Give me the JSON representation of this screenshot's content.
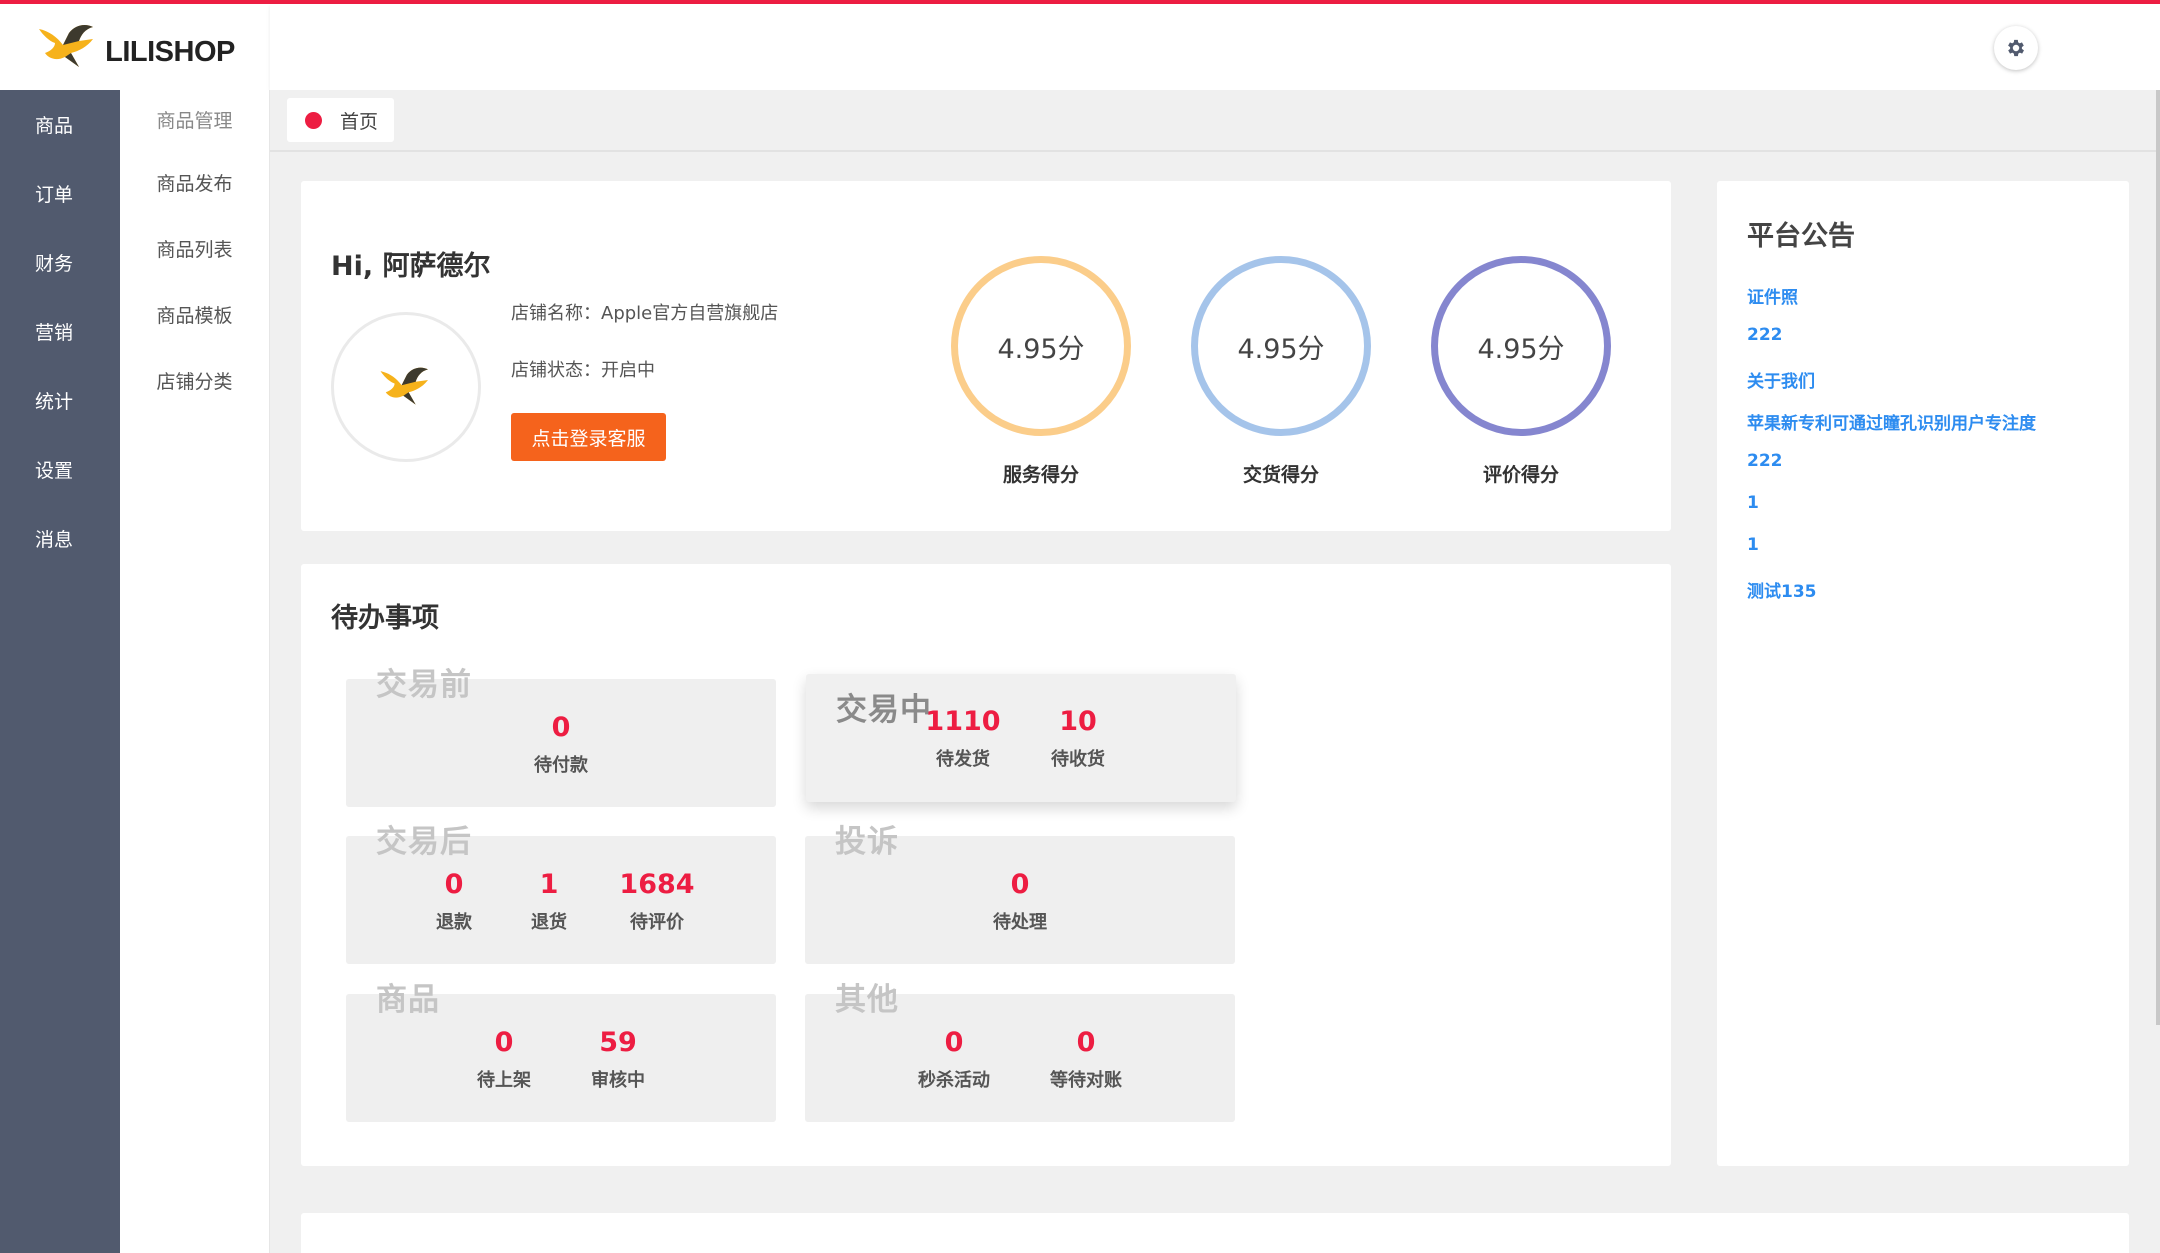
{
  "brand": {
    "name": "LILISHOP"
  },
  "sidebar": {
    "items": [
      "商品",
      "订单",
      "财务",
      "营销",
      "统计",
      "设置",
      "消息"
    ]
  },
  "submenu": {
    "group": "商品管理",
    "items": [
      "商品发布",
      "商品列表",
      "商品模板",
      "店铺分类"
    ]
  },
  "tabs": [
    {
      "label": "首页"
    }
  ],
  "profile": {
    "greeting": "Hi, 阿萨德尔",
    "shop_name": "店铺名称：Apple官方自营旗舰店",
    "shop_status": "店铺状态：开启中",
    "service_button": "点击登录客服",
    "scores": [
      {
        "value": "4.95分",
        "label": "服务得分",
        "color": "#fbcd8a"
      },
      {
        "value": "4.95分",
        "label": "交货得分",
        "color": "#a5c4ea"
      },
      {
        "value": "4.95分",
        "label": "评价得分",
        "color": "#8586cf"
      }
    ]
  },
  "todo": {
    "title": "待办事项",
    "groups": [
      {
        "label": "交易前",
        "stats": [
          {
            "num": "0",
            "label": "待付款"
          }
        ]
      },
      {
        "label": "交易中",
        "stats": [
          {
            "num": "1110",
            "label": "待发货"
          },
          {
            "num": "10",
            "label": "待收货"
          }
        ]
      },
      {
        "label": "交易后",
        "stats": [
          {
            "num": "0",
            "label": "退款"
          },
          {
            "num": "1",
            "label": "退货"
          },
          {
            "num": "1684",
            "label": "待评价"
          }
        ]
      },
      {
        "label": "投诉",
        "stats": [
          {
            "num": "0",
            "label": "待处理"
          }
        ]
      },
      {
        "label": "商品",
        "stats": [
          {
            "num": "0",
            "label": "待上架"
          },
          {
            "num": "59",
            "label": "审核中"
          }
        ]
      },
      {
        "label": "其他",
        "stats": [
          {
            "num": "0",
            "label": "秒杀活动"
          },
          {
            "num": "0",
            "label": "等待对账"
          }
        ]
      }
    ]
  },
  "notice": {
    "title": "平台公告",
    "items": [
      "证件照",
      "222",
      "关于我们",
      "苹果新专利可通过瞳孔识别用户专注度",
      "222",
      "1",
      "1",
      "测试135"
    ]
  },
  "colors": {
    "accent": "#ed1d42",
    "sidebar": "#515a6e",
    "link": "#2d8cf0",
    "button": "#f5631c"
  }
}
